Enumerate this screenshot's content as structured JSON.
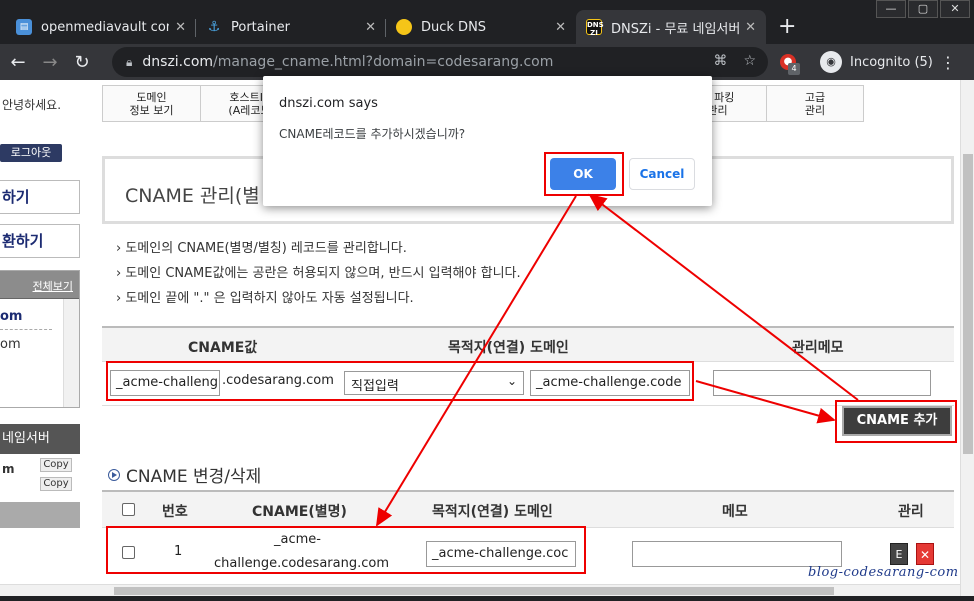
{
  "window": {
    "min": "—",
    "max": "▢",
    "close": "✕"
  },
  "tabs": [
    {
      "title": "openmediavault control",
      "favicon": "omv",
      "color": "#4a90d9"
    },
    {
      "title": "Portainer",
      "favicon": "P",
      "color": "#1b8fd1"
    },
    {
      "title": "Duck DNS",
      "favicon": "🦆",
      "color": "#f5c518"
    },
    {
      "title": "DNSZi - 무료 네임서버(d",
      "favicon": "DNS",
      "color": "#222"
    }
  ],
  "newtab": "+",
  "toolbar": {
    "back": "←",
    "forward": "→",
    "reload": "↻",
    "url_host": "dnszi.com",
    "url_rest": "/manage_cname.html?domain=codesarang.com",
    "ext_badge": "4",
    "incognito": "Incognito (5)",
    "menu": "⋮"
  },
  "left": {
    "greeting": "안녕하세요.",
    "logout": "로그아웃",
    "box1": "하기",
    "box2": "환하기",
    "list_all": "전체보기",
    "list_item1": "om",
    "list_item2": "om",
    "nameserver": "네임서버",
    "ns_label": "m",
    "copy": "Copy"
  },
  "menu": [
    {
      "line1": "도메인",
      "line2": "정보 보기"
    },
    {
      "line1": "호스트IP",
      "line2": "(A레코드"
    },
    {
      "line1": "웹 파킹",
      "line2": "관리"
    },
    {
      "line1": "고급",
      "line2": "관리"
    }
  ],
  "section1": {
    "title": "CNAME 관리(별",
    "notes": [
      "도메인의 CNAME(별명/별칭) 레코드를 관리합니다.",
      "도메인 CNAME값에는 공란은 허용되지 않으며, 반드시 입력해야 합니다.",
      "도메인 끝에 \".\" 은 입력하지 않아도 자동 설정됩니다."
    ],
    "col_cname": "CNAME값",
    "col_target": "목적지(연결) 도메인",
    "col_memo": "관리메모",
    "cname_value": "_acme-challeng",
    "cname_suffix": ".codesarang.com",
    "select_value": "직접입력",
    "target_value": "_acme-challenge.code",
    "memo_value": "",
    "add_button": "CNAME 추가"
  },
  "section2": {
    "title": "CNAME 변경/삭제",
    "col_no": "번호",
    "col_cname": "CNAME(별명)",
    "col_target": "목적지(연결) 도메인",
    "col_memo": "메모",
    "col_manage": "관리",
    "rows": [
      {
        "no": "1",
        "cname_line1": "_acme-",
        "cname_line2": "challenge.codesarang.com",
        "target": "_acme-challenge.coc",
        "memo": "",
        "edit": "E",
        "delete": "✕"
      }
    ]
  },
  "dialog": {
    "title": "dnszi.com says",
    "message": "CNAME레코드를 추가하시겠습니까?",
    "ok": "OK",
    "cancel": "Cancel"
  },
  "watermark": "blog-codesarang-com"
}
